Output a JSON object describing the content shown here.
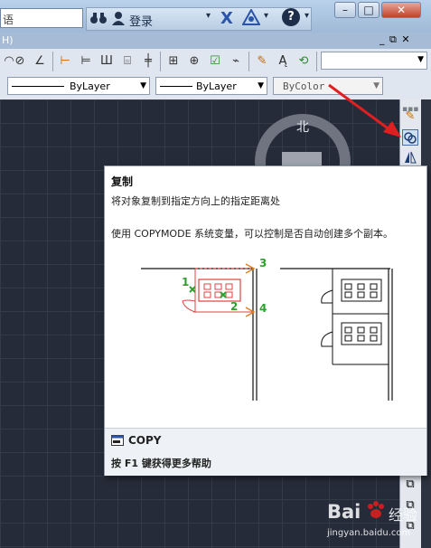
{
  "titlebar": {
    "search_text": "语",
    "login_label": "登录",
    "help_symbol": "?",
    "minimize_symbol": "–",
    "maximize_symbol": "□",
    "close_symbol": "✕",
    "binocular_icon": "binoculars-icon",
    "user_icon": "user-icon",
    "x_logo": "X"
  },
  "docbar": {
    "left_text": "H)",
    "window_controls": "_ ⧉ ✕"
  },
  "properties": {
    "linetype": "ByLayer",
    "lineweight": "ByLayer",
    "plotstyle": "ByColor"
  },
  "viewcube": {
    "north_label": "北"
  },
  "tooltip": {
    "title": "复制",
    "description": "将对象复制到指定方向上的指定距离处",
    "detail": "使用 COPYMODE 系统变量，可以控制是否自动创建多个副本。",
    "callouts": [
      "1",
      "2",
      "3",
      "4"
    ],
    "command_name": "COPY",
    "help_text": "按 F1 键获得更多帮助"
  },
  "watermark": {
    "brand": "Bai",
    "brand_suffix": "经验",
    "url": "jingyan.baidu.com"
  },
  "colors": {
    "arrow": "#e02020",
    "callout_green": "#2da02d",
    "selection_red": "#e04040"
  }
}
